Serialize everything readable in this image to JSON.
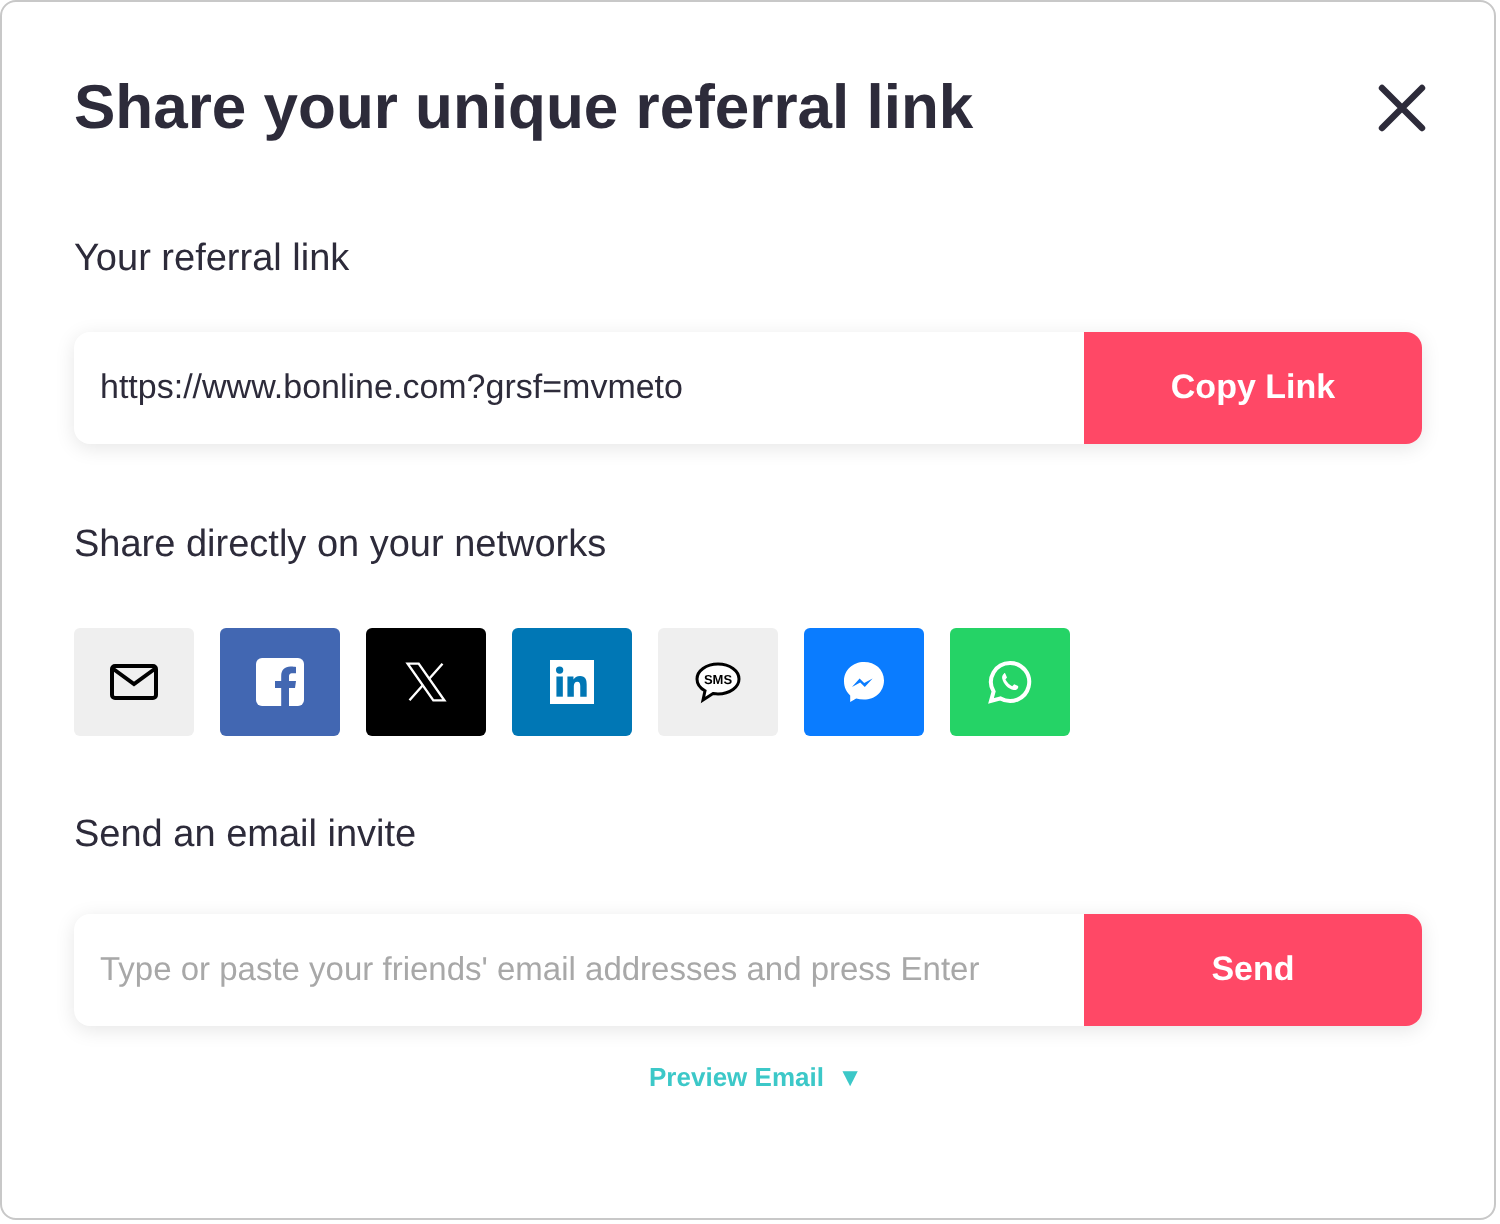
{
  "title": "Share your unique referral link",
  "referral": {
    "label": "Your referral link",
    "value": "https://www.bonline.com?grsf=mvmeto",
    "button": "Copy Link"
  },
  "networks_label": "Share directly on your networks",
  "networks": [
    {
      "kind": "email",
      "color": "#efefef"
    },
    {
      "kind": "facebook",
      "color": "#4267b2"
    },
    {
      "kind": "x",
      "color": "#000000"
    },
    {
      "kind": "linkedin",
      "color": "#0077b5"
    },
    {
      "kind": "sms",
      "color": "#efefef",
      "icon_text": "SMS"
    },
    {
      "kind": "messenger",
      "color": "#0a7cff"
    },
    {
      "kind": "whatsapp",
      "color": "#25d366"
    }
  ],
  "invite": {
    "label": "Send an email invite",
    "placeholder": "Type or paste your friends' email addresses and press Enter",
    "button": "Send"
  },
  "preview": {
    "label": "Preview Email",
    "caret": "▼"
  }
}
